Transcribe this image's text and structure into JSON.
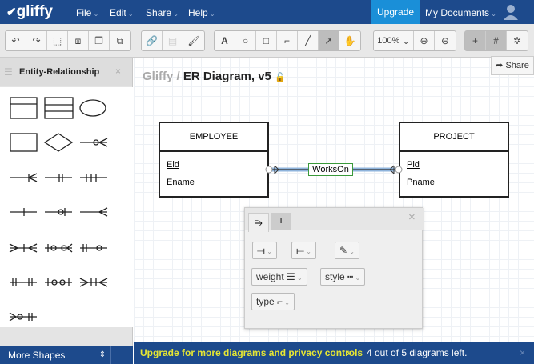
{
  "app": {
    "logo": "gliffy",
    "menus": [
      "File",
      "Edit",
      "Share",
      "Help"
    ],
    "upgrade": "Upgrade",
    "my_documents": "My Documents"
  },
  "toolbar": {
    "zoom": "100%",
    "text_tool": "A"
  },
  "sidebar": {
    "title": "Entity-Relationship",
    "close": "×",
    "more_shapes": "More Shapes"
  },
  "breadcrumb": {
    "root": "Gliffy /",
    "title": "ER Diagram, v5"
  },
  "share_button": "Share",
  "diagram": {
    "entities": [
      {
        "name": "EMPLOYEE",
        "attributes": [
          "Eid",
          "Ename"
        ]
      },
      {
        "name": "PROJECT",
        "attributes": [
          "Pid",
          "Pname"
        ]
      }
    ],
    "relationship": "WorksOn"
  },
  "line_panel": {
    "tab_text": "T",
    "weight": "weight",
    "style": "style",
    "type": "type",
    "close": "×"
  },
  "banner": {
    "upgrade_text": "Upgrade for more diagrams and privacy controls",
    "arrows": "»",
    "status": "4 out of 5 diagrams left.",
    "close": "×"
  },
  "colors": {
    "brand": "#1d4a8c",
    "upgrade": "#1a8fd8",
    "banner_link": "#e6e633",
    "relationship_border": "#3a9a3a",
    "connector": "#4a7fb5"
  }
}
